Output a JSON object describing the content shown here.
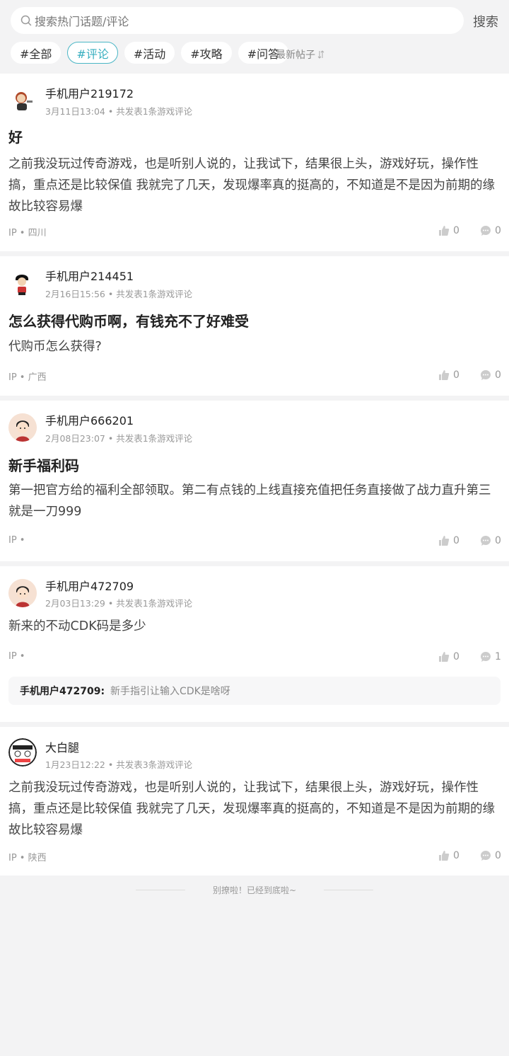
{
  "search": {
    "placeholder": "搜索热门话题/评论",
    "button": "搜索"
  },
  "tags": [
    "#全部",
    "#评论",
    "#活动",
    "#攻略",
    "#问答"
  ],
  "sort_label": "最新帖子",
  "posts": [
    {
      "username": "手机用户219172",
      "meta": "3月11日13:04 • 共发表1条游戏评论",
      "title": "好",
      "body": "之前我没玩过传奇游戏，也是听别人说的，让我试下，结果很上头，游戏好玩，操作性搞，重点还是比较保值 我就完了几天，发现爆率真的挺高的，不知道是不是因为前期的缘故比较容易爆",
      "ip": "IP • 四川",
      "likes": "0",
      "comments": "0"
    },
    {
      "username": "手机用户214451",
      "meta": "2月16日15:56 • 共发表1条游戏评论",
      "title": "怎么获得代购币啊，有钱充不了好难受",
      "body": "代购币怎么获得?",
      "ip": "IP • 广西",
      "likes": "0",
      "comments": "0"
    },
    {
      "username": "手机用户666201",
      "meta": "2月08日23:07 • 共发表1条游戏评论",
      "title": "新手福利码",
      "body": "第一把官方给的福利全部领取。第二有点钱的上线直接充值把任务直接做了战力直升第三就是一刀999",
      "ip": "IP •",
      "likes": "0",
      "comments": "0"
    },
    {
      "username": "手机用户472709",
      "meta": "2月03日13:29 • 共发表1条游戏评论",
      "body": "新来的不动CDK码是多少",
      "ip": "IP •",
      "likes": "0",
      "comments": "1",
      "reply": {
        "name": "手机用户472709:",
        "text": "新手指引让输入CDK是啥呀"
      }
    },
    {
      "username": "大白腿",
      "meta": "1月23日12:22 • 共发表3条游戏评论",
      "body": "之前我没玩过传奇游戏，也是听别人说的，让我试下，结果很上头，游戏好玩，操作性搞，重点还是比较保值 我就完了几天，发现爆率真的挺高的，不知道是不是因为前期的缘故比较容易爆",
      "ip": "IP • 陕西",
      "likes": "0",
      "comments": "0"
    }
  ],
  "footer": "别撩啦！已经到底啦~"
}
